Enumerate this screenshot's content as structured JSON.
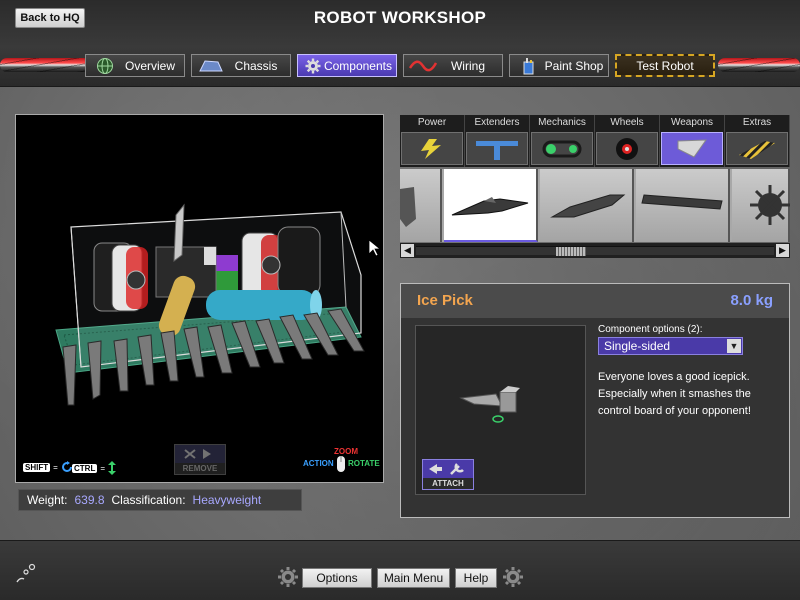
{
  "header": {
    "back_label": "Back to HQ",
    "title": "ROBOT WORKSHOP"
  },
  "nav": {
    "tabs": [
      {
        "label": "Overview",
        "icon": "globe-icon"
      },
      {
        "label": "Chassis",
        "icon": "chassis-icon"
      },
      {
        "label": "Components",
        "icon": "gear-icon",
        "active": true
      },
      {
        "label": "Wiring",
        "icon": "wire-icon"
      },
      {
        "label": "Paint Shop",
        "icon": "paint-can-icon"
      },
      {
        "label": "Test Robot"
      }
    ]
  },
  "viewport": {
    "hint_shift": "SHIFT",
    "hint_ctrl": "CTRL",
    "remove_label": "REMOVE",
    "action_label": "ACTION",
    "zoom_label": "ZOOM",
    "rotate_label": "ROTATE"
  },
  "stats": {
    "weight_label": "Weight:",
    "weight_value": "639.8",
    "class_label": "Classification:",
    "class_value": "Heavyweight"
  },
  "categories": [
    "Power",
    "Extenders",
    "Mechanics",
    "Wheels",
    "Weapons",
    "Extras"
  ],
  "active_category": "Weapons",
  "part": {
    "name": "Ice Pick",
    "weight": "8.0 kg",
    "attach_label": "ATTACH",
    "options_label": "Component options (2):",
    "selected_option": "Single-sided",
    "description": "Everyone loves a good icepick. Especially when it smashes the control board of your opponent!"
  },
  "footer": {
    "options_label": "Options",
    "main_menu_label": "Main Menu",
    "help_label": "Help"
  },
  "colors": {
    "accent": "#6d5bd8",
    "part_name": "#f3a54f",
    "weight_value": "#8aa0ff",
    "test_border": "#d6a623"
  }
}
